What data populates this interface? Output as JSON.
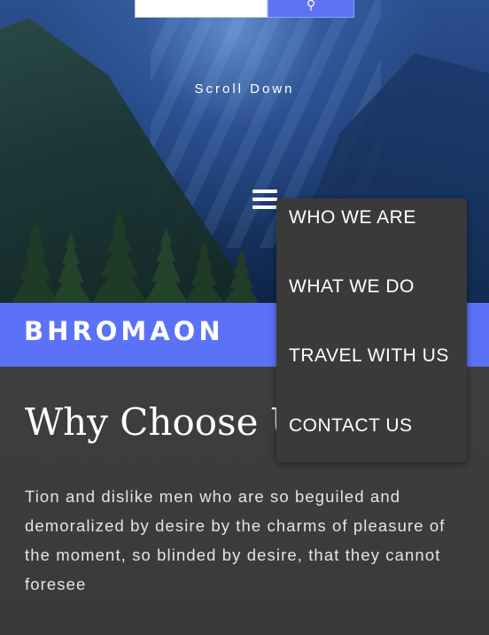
{
  "hero": {
    "scroll_label": "Scroll Down",
    "search_button_icon": "search-icon"
  },
  "brand": {
    "name": "BHROMAON"
  },
  "menu": {
    "items": [
      {
        "label": "WHO WE ARE"
      },
      {
        "label": "WHAT WE DO"
      },
      {
        "label": "TRAVEL WITH US"
      },
      {
        "label": "CONTACT US"
      }
    ]
  },
  "section": {
    "heading": "Why Choose U",
    "paragraph": "Tion and dislike men who are so beguiled and demoralized by desire by the charms of pleasure of the moment, so blinded by desire, that they cannot foresee"
  },
  "colors": {
    "accent": "#5b72f7",
    "dropdown_bg": "#3a3a3a",
    "content_bg": "#3e3e3e",
    "scroll_icon": "#7a2fd0"
  }
}
